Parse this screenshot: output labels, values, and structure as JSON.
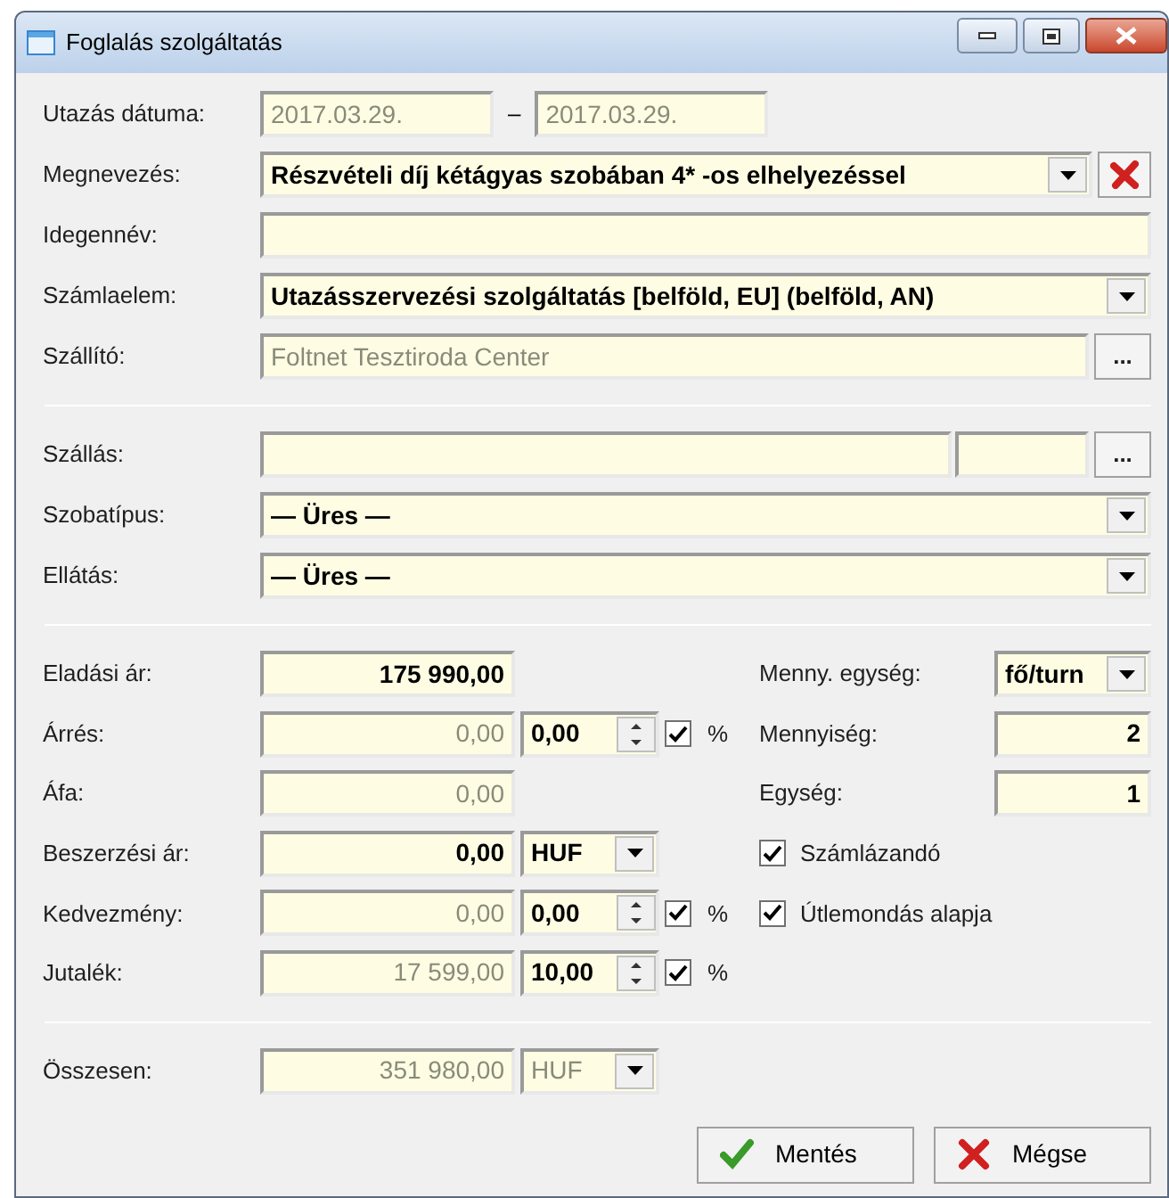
{
  "window": {
    "title": "Foglalás szolgáltatás"
  },
  "travel_date": {
    "label": "Utazás dátuma:",
    "from": "2017.03.29.",
    "separator": "–",
    "to": "2017.03.29."
  },
  "general": [
    {
      "kind": "combo_clear",
      "label": "Megnevezés:",
      "value": "Részvételi díj kétágyas szobában 4* -os elhelyezéssel",
      "disabled": false
    },
    {
      "kind": "text",
      "label": "Idegennév:"
    },
    {
      "kind": "combo",
      "label": "Számlaelem:",
      "value": "Utazásszervezési szolgáltatás [belföld, EU] (belföld, AN)",
      "disabled": false
    },
    {
      "kind": "browse",
      "label": "Szállító:",
      "value": "Foltnet Tesztiroda Center",
      "disabled": true,
      "button_label": "..."
    }
  ],
  "accommodation": [
    {
      "kind": "browse_split",
      "label": "Szállás:",
      "button_label": "..."
    },
    {
      "kind": "combo",
      "label": "Szobatípus:",
      "value": "— Üres —",
      "disabled": false
    },
    {
      "kind": "combo",
      "label": "Ellátás:",
      "value": "— Üres —",
      "disabled": false
    }
  ],
  "prices": [
    {
      "kind": "amount",
      "label": "Eladási ár:",
      "value": "175 990,00",
      "disabled": false
    },
    {
      "kind": "amount_pct",
      "label": "Árrés:",
      "value": "0,00",
      "disabled": true,
      "pct": "0,00",
      "checked": true,
      "unit": "%"
    },
    {
      "kind": "amount",
      "label": "Áfa:",
      "value": "0,00",
      "disabled": true
    },
    {
      "kind": "amount_currency",
      "label": "Beszerzési ár:",
      "value": "0,00",
      "disabled": false,
      "currency": "HUF",
      "currency_disabled": false
    },
    {
      "kind": "amount_pct",
      "label": "Kedvezmény:",
      "value": "0,00",
      "disabled": true,
      "pct": "0,00",
      "checked": true,
      "unit": "%"
    },
    {
      "kind": "amount_pct",
      "label": "Jutalék:",
      "value": "17 599,00",
      "disabled": true,
      "pct": "10,00",
      "checked": true,
      "unit": "%"
    }
  ],
  "quantity": [
    {
      "kind": "combo",
      "label": "Menny. egység:",
      "value": "fő/turn"
    },
    {
      "kind": "number",
      "label": "Mennyiség:",
      "value": "2"
    },
    {
      "kind": "number",
      "label": "Egység:",
      "value": "1"
    },
    {
      "kind": "checkbox",
      "label": "Számlázandó",
      "checked": true
    },
    {
      "kind": "checkbox",
      "label": "Útlemondás alapja",
      "checked": true
    }
  ],
  "total": {
    "kind": "amount_currency",
    "label": "Összesen:",
    "value": "351 980,00",
    "disabled": true,
    "currency": "HUF",
    "currency_disabled": true
  },
  "buttons": [
    {
      "kind": "save",
      "label": "Mentés"
    },
    {
      "kind": "cancel",
      "label": "Mégse"
    }
  ]
}
